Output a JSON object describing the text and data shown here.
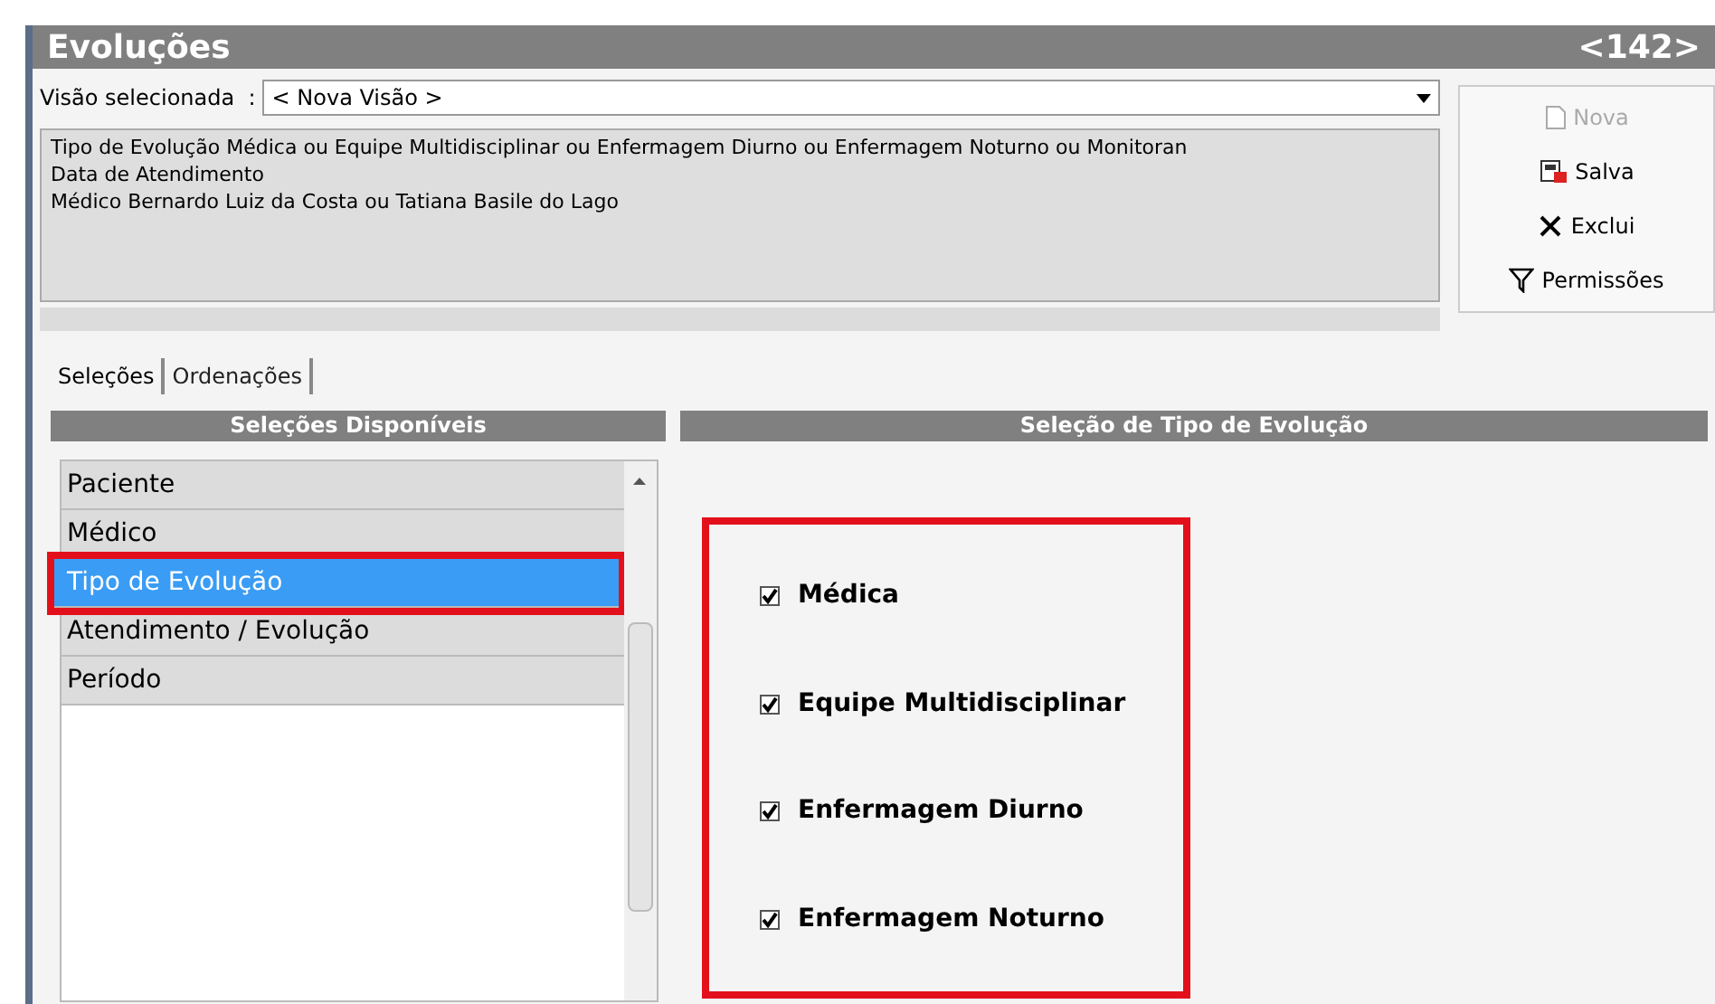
{
  "window": {
    "title": "Evoluções",
    "counter": "<142>"
  },
  "view": {
    "label": "Visão selecionada  :",
    "value": "< Nova Visão >"
  },
  "filter_lines": [
    "Tipo de Evolução Médica ou Equipe Multidisciplinar ou Enfermagem Diurno ou Enfermagem Noturno ou Monitoran",
    "Data de Atendimento",
    "Médico Bernardo Luiz da Costa ou Tatiana Basile do Lago"
  ],
  "actions": [
    {
      "kind": "new",
      "label": "Nova",
      "disabled": true
    },
    {
      "kind": "save",
      "label": "Salva",
      "disabled": false
    },
    {
      "kind": "delete",
      "label": "Exclui",
      "disabled": false
    },
    {
      "kind": "permissions",
      "label": "Permissões",
      "disabled": false
    }
  ],
  "tabs": [
    {
      "label": "Seleções",
      "selected": true
    },
    {
      "label": "Ordenações",
      "selected": false
    }
  ],
  "available": {
    "header": "Seleções Disponíveis",
    "items": [
      {
        "label": "Paciente",
        "selected": false,
        "highlighted": false
      },
      {
        "label": "Médico",
        "selected": false,
        "highlighted": false
      },
      {
        "label": "Tipo de Evolução",
        "selected": true,
        "highlighted": true
      },
      {
        "label": "Atendimento / Evolução",
        "selected": false,
        "highlighted": false
      },
      {
        "label": "Período",
        "selected": false,
        "highlighted": false
      }
    ]
  },
  "selection": {
    "header": "Seleção de Tipo de Evolução",
    "highlighted": true,
    "options": [
      {
        "label": "Médica",
        "checked": true
      },
      {
        "label": "Equipe Multidisciplinar",
        "checked": true
      },
      {
        "label": "Enfermagem Diurno",
        "checked": true
      },
      {
        "label": "Enfermagem Noturno",
        "checked": true
      }
    ]
  }
}
